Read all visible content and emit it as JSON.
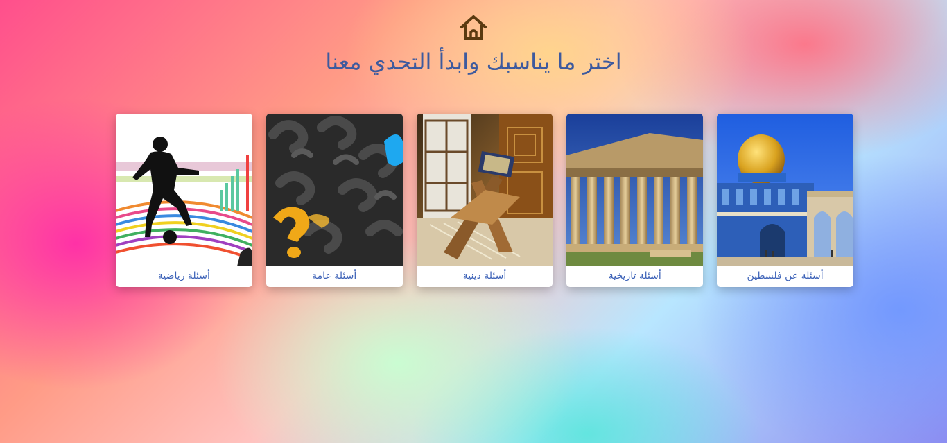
{
  "header": {
    "icon": "home-icon",
    "title": "اختر ما يناسبك وابدأ التحدي معنا",
    "icon_color": "#5a3a10",
    "title_color": "#3d5a9e"
  },
  "cards": [
    {
      "label": "أسئلة عن فلسطين",
      "image": "dome-of-the-rock"
    },
    {
      "label": "أسئلة تاريخية",
      "image": "parthenon-ruins"
    },
    {
      "label": "أسئلة دينية",
      "image": "quran-on-stand"
    },
    {
      "label": "أسئلة عامة",
      "image": "question-marks"
    },
    {
      "label": "أسئلة رياضية",
      "image": "football-player-silhouette"
    }
  ]
}
